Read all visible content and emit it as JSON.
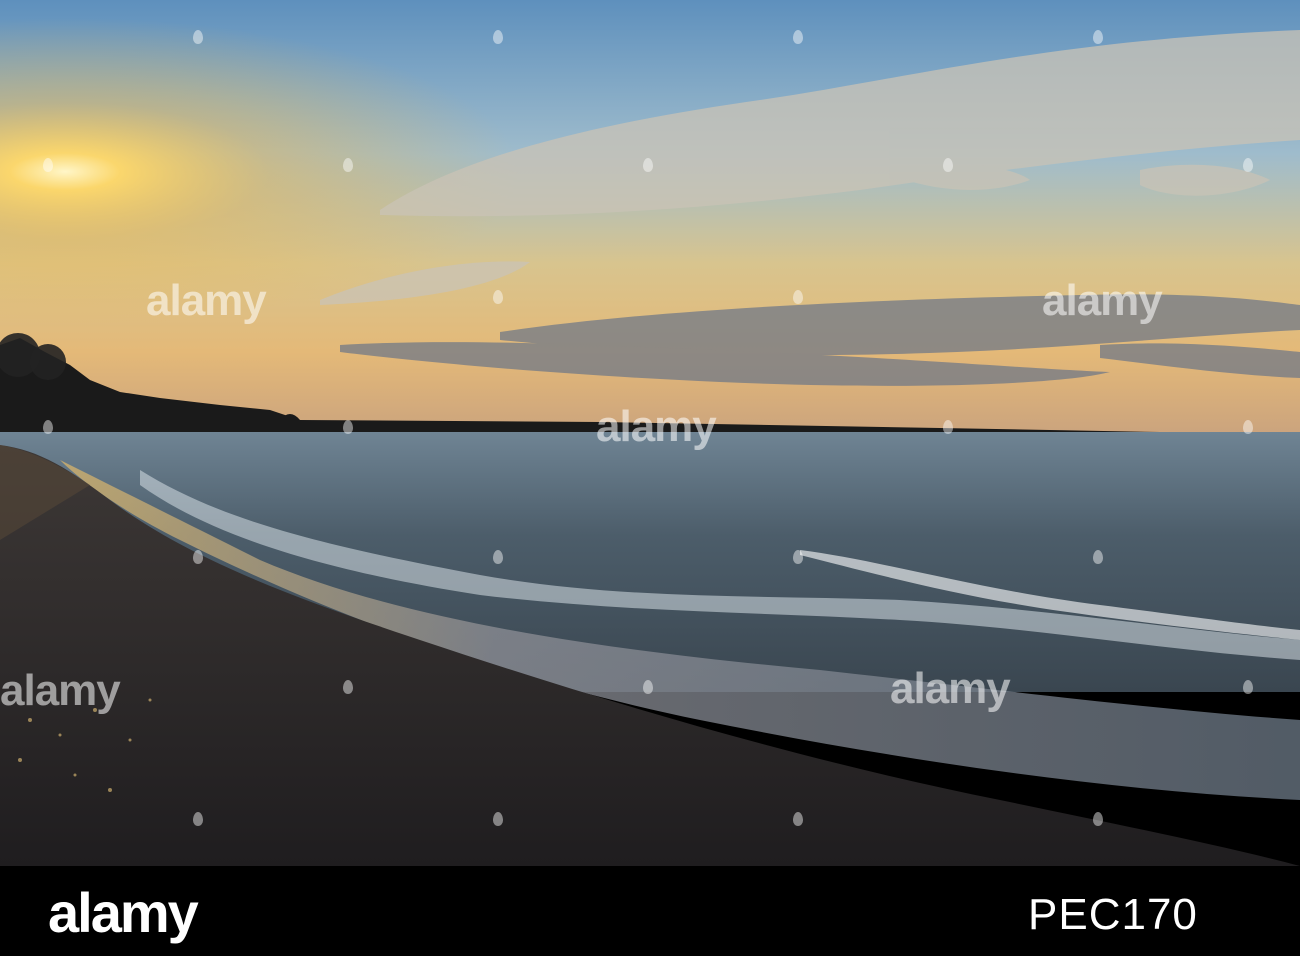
{
  "watermark": {
    "brand": "alamy"
  },
  "footer": {
    "logo": "alamy",
    "image_id": "PEC170"
  },
  "colors": {
    "sky_top": "#6d9cc4",
    "sky_mid": "#b9c7c9",
    "horizon_glow": "#f2c25a",
    "sea": "#4a5a68",
    "sand": "#2f2c2d",
    "footer_bg": "#000000"
  }
}
